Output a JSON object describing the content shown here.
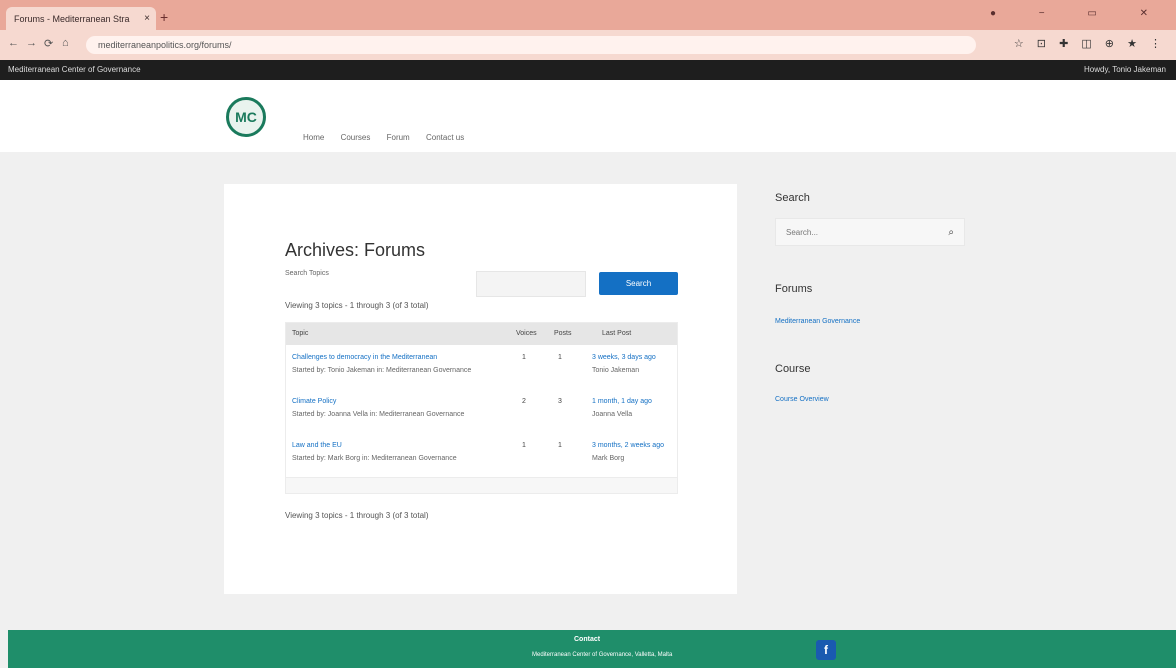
{
  "browser": {
    "tab_title": "Forums - Mediterranean Stra",
    "tab_close": "×",
    "new_tab": "+",
    "window_controls": "● − ▭ ✕",
    "nav_buttons": [
      "←",
      "→",
      "⟳",
      "⌂"
    ],
    "url": "mediterraneanpolitics.org/forums/",
    "extensions": "☆ ⊡ ✚ ◫ ⊕ ★ ⋮"
  },
  "admin_bar": {
    "site_name": "Mediterranean Center of Governance",
    "howdy": "Howdy, Tonio Jakeman"
  },
  "header": {
    "logo": "MC",
    "nav": [
      "Home",
      "Courses",
      "Forum",
      "Contact us"
    ]
  },
  "main": {
    "title": "Archives: Forums",
    "forum_label": "Search Topics",
    "search_button": "Search",
    "viewing_text": "Viewing 3 topics - 1 through 3 (of 3 total)",
    "table_headers": [
      "Topic",
      "Voices",
      "Posts",
      "Last Post"
    ],
    "rows": [
      {
        "title": "Challenges to democracy in the Mediterranean",
        "meta": "Started by: Tonio Jakeman in: Mediterranean Governance",
        "voices": "1",
        "posts": "1",
        "last": "3 weeks, 3 days ago",
        "last_by": "Tonio Jakeman"
      },
      {
        "title": "Climate Policy",
        "meta": "Started by: Joanna Vella in: Mediterranean Governance",
        "voices": "2",
        "posts": "3",
        "last": "1 month, 1 day ago",
        "last_by": "Joanna Vella"
      },
      {
        "title": "Law and the EU",
        "meta": "Started by: Mark Borg in: Mediterranean Governance",
        "voices": "1",
        "posts": "1",
        "last": "3 months, 2 weeks ago",
        "last_by": "Mark Borg"
      }
    ]
  },
  "sidebar": {
    "search_title": "Search",
    "search_placeholder": "Search...",
    "search_icon": "⌕",
    "forums_title": "Forums",
    "forums_link": "Mediterranean Governance",
    "course_title": "Course",
    "course_link": "Course Overview"
  },
  "footer": {
    "title": "Contact",
    "text": "Mediterranean Center of Governance, Valletta, Malta",
    "fb": "f"
  }
}
